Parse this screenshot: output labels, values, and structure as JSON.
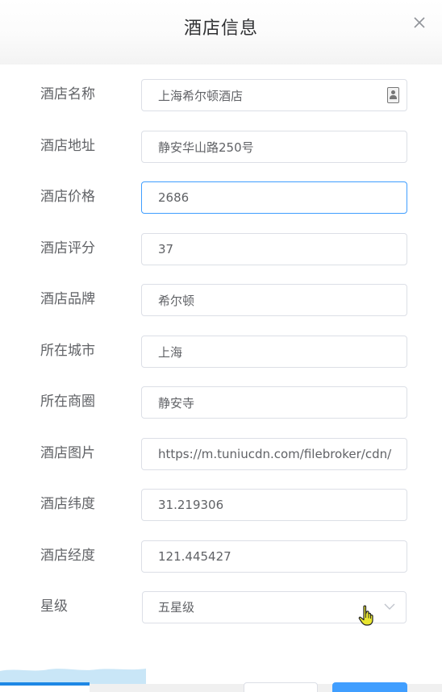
{
  "dialog": {
    "title": "酒店信息",
    "close_icon": "close-icon"
  },
  "form": {
    "name": {
      "label": "酒店名称",
      "value": "上海希尔顿酒店"
    },
    "address": {
      "label": "酒店地址",
      "value": "静安华山路250号"
    },
    "price": {
      "label": "酒店价格",
      "value": "2686"
    },
    "score": {
      "label": "酒店评分",
      "value": "37"
    },
    "brand": {
      "label": "酒店品牌",
      "value": "希尔顿"
    },
    "city": {
      "label": "所在城市",
      "value": "上海"
    },
    "business": {
      "label": "所在商圈",
      "value": "静安寺"
    },
    "pic": {
      "label": "酒店图片",
      "value": "https://m.tuniucdn.com/filebroker/cdn/res"
    },
    "latitude": {
      "label": "酒店纬度",
      "value": "31.219306"
    },
    "longitude": {
      "label": "酒店经度",
      "value": "121.445427"
    },
    "star": {
      "label": "星级",
      "value": "五星级"
    }
  },
  "colors": {
    "focus_border": "#409eff",
    "label_text": "#606266",
    "primary_button": "#409eff",
    "progress_bar": "#1e88e5"
  }
}
